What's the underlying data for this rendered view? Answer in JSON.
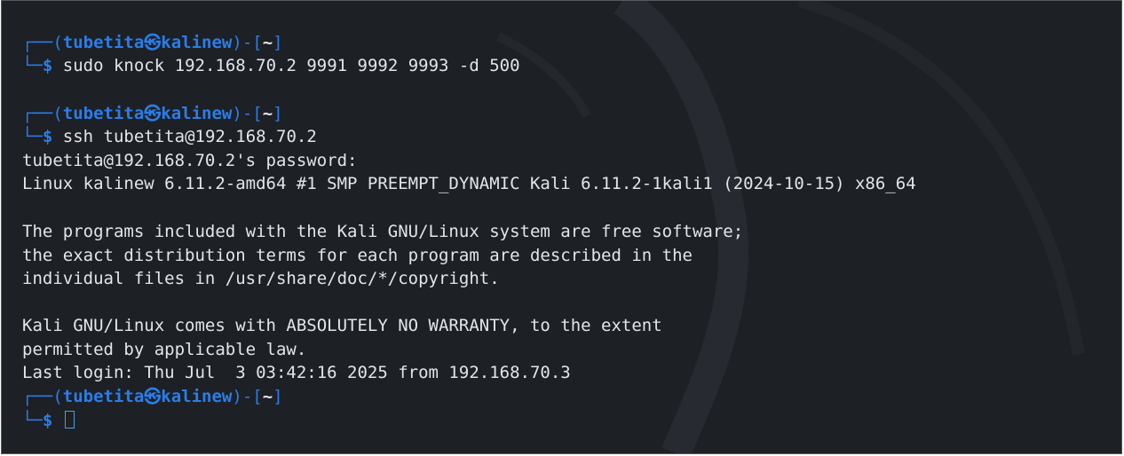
{
  "terminal": {
    "prompt": {
      "user": "tubetita",
      "separator": "㉿",
      "host": "kalinew",
      "path": "~",
      "dollar": "$"
    },
    "top_partial": "",
    "commands": [
      "sudo knock 192.168.70.2 9991 9992 9993 -d 500",
      "ssh tubetita@192.168.70.2"
    ],
    "output": {
      "password_prompt": "tubetita@192.168.70.2's password:",
      "uname": "Linux kalinew 6.11.2-amd64 #1 SMP PREEMPT_DYNAMIC Kali 6.11.2-1kali1 (2024-10-15) x86_64",
      "motd1": "The programs included with the Kali GNU/Linux system are free software;",
      "motd2": "the exact distribution terms for each program are described in the",
      "motd3": "individual files in /usr/share/doc/*/copyright.",
      "motd4": "Kali GNU/Linux comes with ABSOLUTELY NO WARRANTY, to the extent",
      "motd5": "permitted by applicable law.",
      "last_login": "Last login: Thu Jul  3 03:42:16 2025 from 192.168.70.3"
    },
    "colors": {
      "background": "#1d2025",
      "prompt_blue": "#2b7de9",
      "text": "#e3e5e8"
    }
  }
}
